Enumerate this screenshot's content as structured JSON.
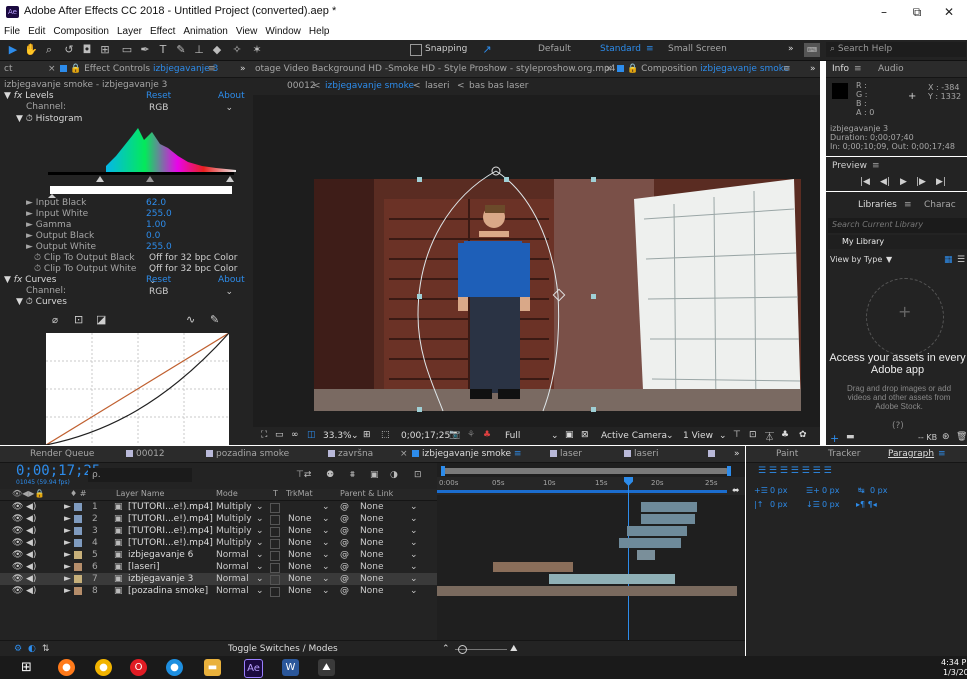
{
  "titlebar": {
    "title": "Adobe After Effects CC 2018 - Untitled Project (converted).aep *",
    "logo": "Ae",
    "minimize": "–",
    "maximize": "⧉",
    "close": "✕"
  },
  "menu": [
    "File",
    "Edit",
    "Composition",
    "Layer",
    "Effect",
    "Animation",
    "View",
    "Window",
    "Help"
  ],
  "toolbar": {
    "snapping": "Snapping",
    "workspaces": [
      "Default",
      "Standard",
      "Small Screen"
    ],
    "search_placeholder": "Search Help",
    "more": "»"
  },
  "effect_panel": {
    "tab_left": "ct",
    "tab_label": "Effect Controls",
    "tab_layer": "izbjegavanje 3",
    "more": "»",
    "breadcrumb": "izbjegavanje smoke - izbjegavanje 3",
    "levels": {
      "name": "Levels",
      "reset": "Reset",
      "about": "About",
      "channel_label": "Channel:",
      "channel_value": "RGB",
      "histogram": "Histogram"
    },
    "params": [
      {
        "label": "Input Black",
        "value": "62.0"
      },
      {
        "label": "Input White",
        "value": "255.0"
      },
      {
        "label": "Gamma",
        "value": "1.00"
      },
      {
        "label": "Output Black",
        "value": "0.0"
      },
      {
        "label": "Output White",
        "value": "255.0"
      }
    ],
    "clip_black": {
      "label": "Clip To Output Black",
      "value": "Off for 32 bpc Color"
    },
    "clip_white": {
      "label": "Clip To Output White",
      "value": "Off for 32 bpc Color"
    },
    "curves": {
      "name": "Curves",
      "reset": "Reset",
      "about": "About",
      "channel_label": "Channel:",
      "channel_value": "RGB",
      "label": "Curves"
    }
  },
  "viewer_tabs": {
    "footage": "otage Video Background HD -Smoke HD - Style Proshow - styleproshow.org.mp4",
    "comp_label": "Composition",
    "comp_name": "izbjegavanje smoke",
    "more": "»",
    "breadcrumbs": [
      "00012",
      "izbjegavanje smoke",
      "laseri",
      "bas bas laser"
    ]
  },
  "viewer_footer": {
    "zoom": "33.3%",
    "timecode": "0;00;17;25",
    "resolution": "Full",
    "camera": "Active Camera",
    "views": "1 View"
  },
  "info_panel": {
    "tabs": [
      "Info",
      "Audio"
    ],
    "r": "R :",
    "g": "G :",
    "b": "B :",
    "a": "A : 0",
    "x": "X : -384",
    "y": "Y : 1332",
    "layer": "izbjegavanje 3",
    "duration": "Duration: 0;00;07;40",
    "inout": "In: 0;00;10;09, Out: 0;00;17;48"
  },
  "preview": {
    "label": "Preview"
  },
  "libraries": {
    "tabs": [
      "Libraries",
      "Charac"
    ],
    "search": "Search Current Library",
    "library": "My Library",
    "view": "View by Type",
    "headline": "Access your assets in every Adobe app",
    "body": "Drag and drop images or add videos and other assets from Adobe Stock.",
    "help": "(?)",
    "size": "-- KB"
  },
  "timeline": {
    "tabs": [
      "Render Queue",
      "00012",
      "pozadina smoke",
      "završna",
      "izbjegavanje smoke",
      "laser",
      "laseri"
    ],
    "more": "»",
    "timecode": "0;00;17;25",
    "timecode_sub": "01045 (59.94 fps)",
    "search": "ρ.",
    "columns": {
      "layer_name": "Layer Name",
      "mode": "Mode",
      "t": "T",
      "trkmat": "TrkMat",
      "parent": "Parent & Link"
    },
    "ruler": [
      "0:00s",
      "05s",
      "10s",
      "15s",
      "20s",
      "25s"
    ],
    "layers": [
      {
        "num": "1",
        "name": "[TUTORI...e!).mp4]",
        "mode": "Multiply",
        "trkmat": "",
        "parent": "None",
        "color": "#7f9bbf"
      },
      {
        "num": "2",
        "name": "[TUTORI...e!).mp4]",
        "mode": "Multiply",
        "trkmat": "None",
        "parent": "None",
        "color": "#7f9bbf"
      },
      {
        "num": "3",
        "name": "[TUTORI...e!).mp4]",
        "mode": "Multiply",
        "trkmat": "None",
        "parent": "None",
        "color": "#7f9bbf"
      },
      {
        "num": "4",
        "name": "[TUTORI...e!).mp4]",
        "mode": "Multiply",
        "trkmat": "None",
        "parent": "None",
        "color": "#7f9bbf"
      },
      {
        "num": "5",
        "name": "izbjegavanje 6",
        "mode": "Normal",
        "trkmat": "None",
        "parent": "None",
        "color": "#c7b07a"
      },
      {
        "num": "6",
        "name": "[laseri]",
        "mode": "Normal",
        "trkmat": "None",
        "parent": "None",
        "color": "#b58d6a"
      },
      {
        "num": "7",
        "name": "izbjegavanje 3",
        "mode": "Normal",
        "trkmat": "None",
        "parent": "None",
        "color": "#c7b07a"
      },
      {
        "num": "8",
        "name": "[pozadina smoke]",
        "mode": "Normal",
        "trkmat": "None",
        "parent": "None",
        "color": "#b58d6a"
      }
    ],
    "toggle": "Toggle Switches / Modes"
  },
  "right_panel": {
    "tabs": [
      "Paint",
      "Tracker",
      "Paragraph"
    ],
    "px": "0 px"
  },
  "taskbar": {
    "time": "4:34 PM",
    "date": "1/3/20"
  },
  "colors": {
    "accent": "#2d8ceb",
    "panel": "#232323",
    "dark": "#1d1d1d"
  }
}
